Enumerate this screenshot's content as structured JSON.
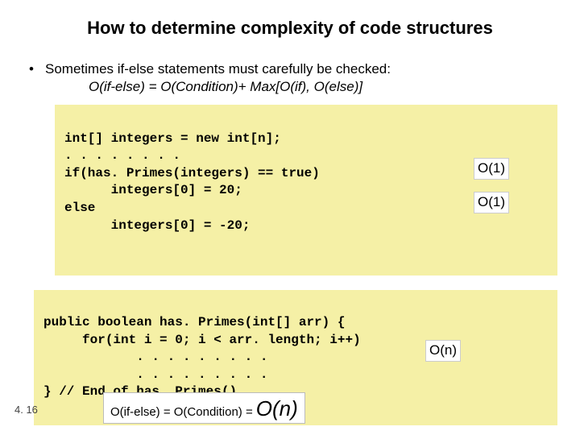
{
  "title": "How to determine complexity of code structures",
  "bullet": "Sometimes if-else statements must carefully be checked:",
  "formula": "O(if-else) = O(Condition)+ Max[O(if), O(else)]",
  "code1": {
    "l1": "int[] integers = new int[n];",
    "l2": ". . . . . . . .",
    "l3": "if(has. Primes(integers) == true)",
    "l4": "      integers[0] = 20;",
    "l5": "else",
    "l6": "      integers[0] = -20;",
    "a1": "O(1)",
    "a2": "O(1)"
  },
  "code2": {
    "l1": "public boolean has. Primes(int[] arr) {",
    "l2": "     for(int i = 0; i < arr. length; i++)",
    "l3": "            . . . . . . . . .",
    "l4": "            . . . . . . . . .",
    "l5": "} // End of has. Primes()",
    "a1": "O(n)"
  },
  "slidenum": "4. 16",
  "conclusion_small": "O(if-else) = O(Condition) = ",
  "conclusion_big": "O(n)"
}
